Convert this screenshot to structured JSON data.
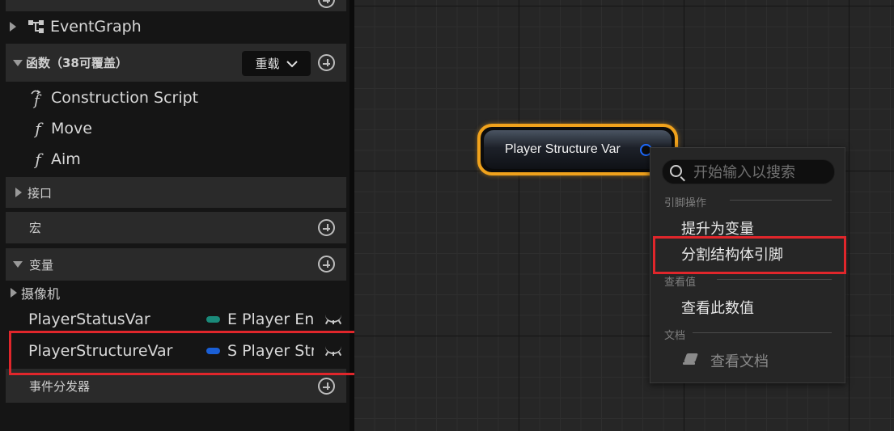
{
  "sidebar": {
    "event_graph": {
      "label": "EventGraph"
    },
    "functions": {
      "header": "函数（38可覆盖）",
      "override_button": "重载",
      "items": [
        {
          "label": "Construction Script",
          "icon": "construction-function-icon"
        },
        {
          "label": "Move",
          "icon": "function-icon"
        },
        {
          "label": "Aim",
          "icon": "function-icon"
        }
      ]
    },
    "interfaces": {
      "header": "接口"
    },
    "macros": {
      "header": "宏"
    },
    "variables": {
      "header": "变量",
      "category": "摄像机",
      "items": [
        {
          "name": "PlayerStatusVar",
          "type": "E Player Enu",
          "type_color": "#1a8a7a"
        },
        {
          "name": "PlayerStructureVar",
          "type": "S Player Stru",
          "type_color": "#1a5fd6"
        }
      ]
    },
    "dispatchers": {
      "header": "事件分发器"
    }
  },
  "graph": {
    "node": {
      "title": "Player Structure Var",
      "border_color": "#f0a21c",
      "pin_color": "#1e6bff"
    }
  },
  "context_menu": {
    "search_placeholder": "开始输入以搜索",
    "sections": [
      {
        "header": "引脚操作",
        "items": [
          "提升为变量",
          "分割结构体引脚"
        ]
      },
      {
        "header": "查看值",
        "items": [
          "查看此数值"
        ]
      },
      {
        "header": "文档",
        "items": [
          "查看文档"
        ]
      }
    ]
  },
  "highlight_color": "#e0262b"
}
